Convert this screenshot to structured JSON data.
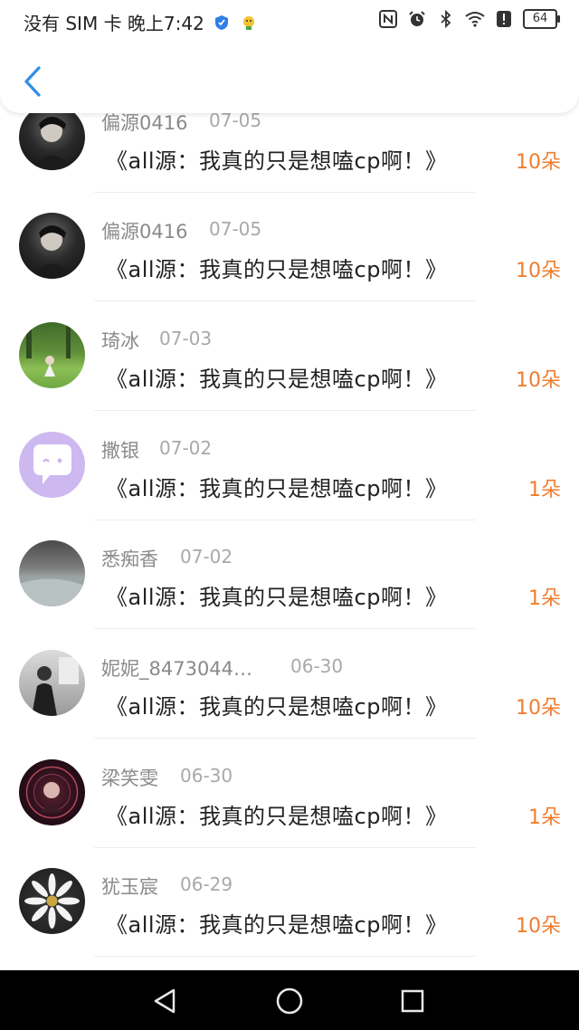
{
  "status_bar": {
    "carrier_time": "没有 SIM 卡 晚上7:42",
    "battery": "64",
    "icons": [
      "shield-icon",
      "app-icon",
      "nfc-icon",
      "alarm-icon",
      "bluetooth-icon",
      "wifi-icon",
      "alert-icon",
      "battery-icon"
    ]
  },
  "header": {
    "back_icon": "chevron-left-icon"
  },
  "rows": [
    {
      "name": "偏源0416",
      "date": "07-05",
      "title": "《all源：我真的只是想嗑cp啊！》",
      "amount": "10朵",
      "avatar": "avatar-dark-portrait"
    },
    {
      "name": "偏源0416",
      "date": "07-05",
      "title": "《all源：我真的只是想嗑cp啊！》",
      "amount": "10朵",
      "avatar": "avatar-dark-portrait"
    },
    {
      "name": "琦冰",
      "date": "07-03",
      "title": "《all源：我真的只是想嗑cp啊！》",
      "amount": "10朵",
      "avatar": "avatar-meadow"
    },
    {
      "name": "撒银",
      "date": "07-02",
      "title": "《all源：我真的只是想嗑cp啊！》",
      "amount": "1朵",
      "avatar": "avatar-chat-bubble"
    },
    {
      "name": "悉痴香",
      "date": "07-02",
      "title": "《all源：我真的只是想嗑cp啊！》",
      "amount": "1朵",
      "avatar": "avatar-gray-landscape"
    },
    {
      "name": "妮妮_8473044…",
      "date": "06-30",
      "title": "《all源：我真的只是想嗑cp啊！》",
      "amount": "10朵",
      "avatar": "avatar-person-bw"
    },
    {
      "name": "梁笑雯",
      "date": "06-30",
      "title": "《all源：我真的只是想嗑cp啊！》",
      "amount": "1朵",
      "avatar": "avatar-dark-red"
    },
    {
      "name": "犹玉宸",
      "date": "06-29",
      "title": "《all源：我真的只是想嗑cp啊！》",
      "amount": "10朵",
      "avatar": "avatar-white-flower"
    }
  ],
  "nav": {
    "back": "nav-back-icon",
    "home": "nav-home-icon",
    "recents": "nav-recents-icon"
  },
  "colors": {
    "amount": "#ef7d2f",
    "accent": "#2f8fe6",
    "name": "#8a8a8a"
  }
}
